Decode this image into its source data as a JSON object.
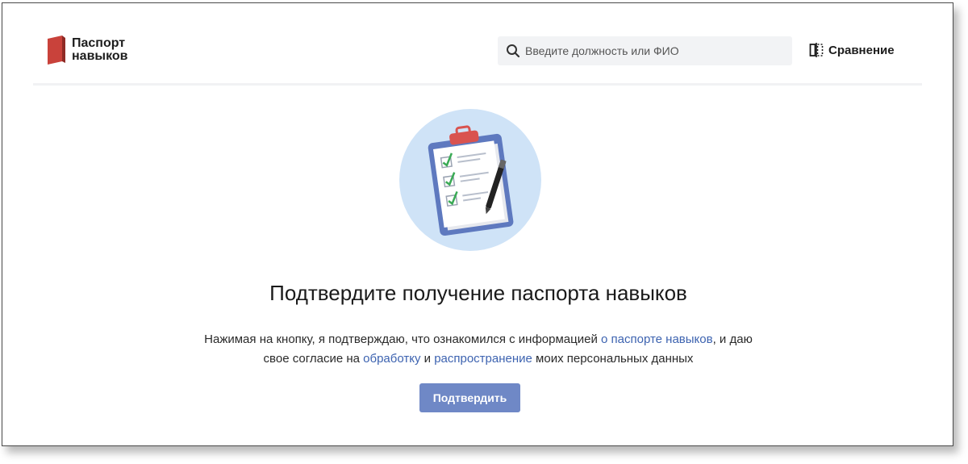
{
  "header": {
    "logo": {
      "line1": "Паспорт",
      "line2": "навыков"
    },
    "search": {
      "placeholder": "Введите должность или ФИО",
      "value": ""
    },
    "compare": {
      "label": "Сравнение",
      "icon": "compare-icon"
    }
  },
  "main": {
    "illustration_icon": "clipboard-checklist-icon",
    "title": "Подтвердите получение паспорта навыков",
    "desc": {
      "part1": "Нажимая на кнопку, я подтверждаю, что ознакомился с информацией ",
      "link1": "о паспорте навыков",
      "part2": ", и даю",
      "part3": "свое согласие на ",
      "link2": "обработку",
      "part4": " и ",
      "link3": "распространение",
      "part5": " моих персональных данных"
    },
    "confirm_label": "Подтвердить"
  },
  "colors": {
    "accent_link": "#3d63b0",
    "button_bg": "#6f88c6",
    "logo_red": "#c9423b"
  }
}
